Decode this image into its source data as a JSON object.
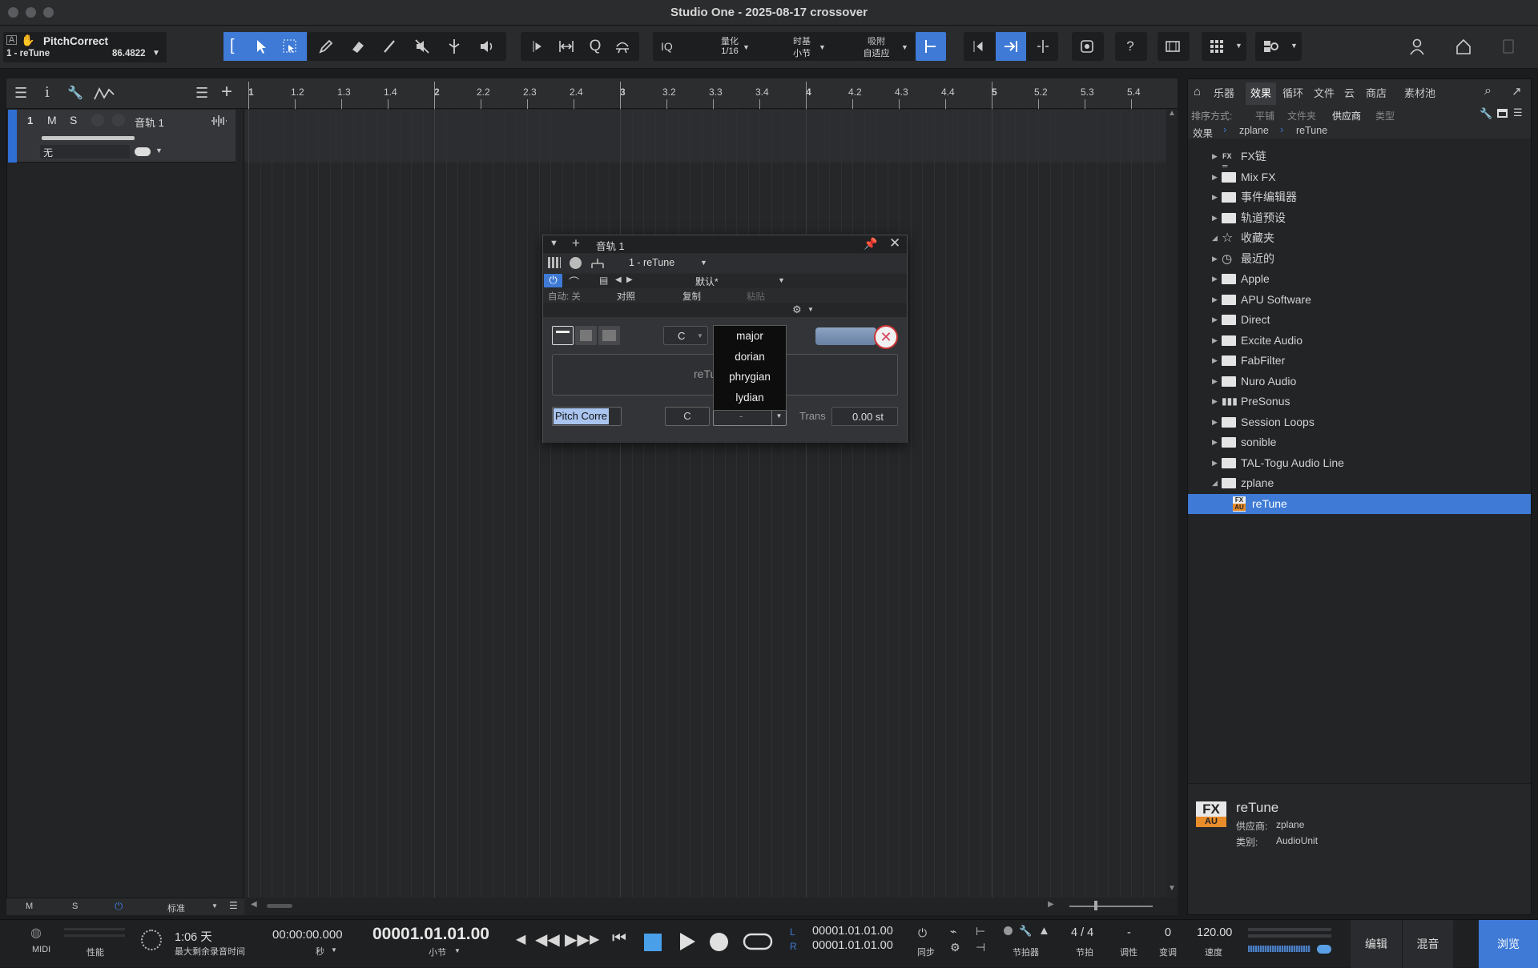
{
  "window": {
    "title": "Studio One - 2025-08-17 crossover"
  },
  "toolbar": {
    "track_name": "PitchCorrect",
    "track_sub": "1 - reTune",
    "track_value": "86.4822",
    "iq": "IQ",
    "quantize_label": "量化",
    "quantize_value": "1/16",
    "timebase_label": "时基",
    "timebase_value": "小节",
    "snap_label": "吸附",
    "snap_value": "自适应",
    "help": "?"
  },
  "ruler": {
    "ticks": [
      "1",
      "1.2",
      "1.3",
      "1.4",
      "2",
      "2.2",
      "2.3",
      "2.4",
      "3",
      "3.2",
      "3.3",
      "3.4",
      "4",
      "4.2",
      "4.3",
      "4.4",
      "5",
      "5.2",
      "5.3",
      "5.4"
    ]
  },
  "track": {
    "number": "1",
    "mute": "M",
    "solo": "S",
    "name": "音轨 1",
    "input": "无"
  },
  "left_footer": {
    "m": "M",
    "s": "S",
    "mode": "标准"
  },
  "plugin": {
    "track": "音轨 1",
    "preset_slot": "1 - reTune",
    "preset_name": "默认*",
    "auto": "自动: 关",
    "compare": "对照",
    "copy": "复制",
    "paste": "粘贴",
    "key": "C",
    "retune_label": "reTu",
    "mode_button": "Pitch Corre",
    "root": "C",
    "scale_value": "-",
    "trans_label": "Trans",
    "trans_value": "0.00 st",
    "scale_options": [
      "major",
      "dorian",
      "phrygian",
      "lydian"
    ]
  },
  "browser": {
    "tabs": [
      "乐器",
      "效果",
      "循环",
      "文件",
      "云",
      "商店",
      "素材池"
    ],
    "active_tab": "效果",
    "sort_label": "排序方式:",
    "sort_options": [
      "平铺",
      "文件夹",
      "供应商",
      "类型"
    ],
    "active_sort": "供应商",
    "breadcrumb": [
      "效果",
      "zplane",
      "reTune"
    ],
    "items": [
      {
        "label": "FX链",
        "icon": "fx-chain"
      },
      {
        "label": "Mix FX",
        "icon": "folder"
      },
      {
        "label": "事件编辑器",
        "icon": "folder"
      },
      {
        "label": "轨道预设",
        "icon": "folder"
      },
      {
        "label": "收藏夹",
        "icon": "star"
      },
      {
        "label": "最近的",
        "icon": "clock"
      },
      {
        "label": "Apple",
        "icon": "folder"
      },
      {
        "label": "APU Software",
        "icon": "folder"
      },
      {
        "label": "Direct",
        "icon": "folder"
      },
      {
        "label": "Excite Audio",
        "icon": "folder"
      },
      {
        "label": "FabFilter",
        "icon": "folder"
      },
      {
        "label": "Nuro Audio",
        "icon": "folder"
      },
      {
        "label": "PreSonus",
        "icon": "presonus"
      },
      {
        "label": "Session Loops",
        "icon": "folder"
      },
      {
        "label": "sonible",
        "icon": "folder"
      },
      {
        "label": "TAL-Togu Audio Line",
        "icon": "folder"
      },
      {
        "label": "zplane",
        "icon": "folder-open"
      },
      {
        "label": "reTune",
        "icon": "fx-au"
      }
    ],
    "info": {
      "name": "reTune",
      "vendor_label": "供应商:",
      "vendor": "zplane",
      "category_label": "类别:",
      "category": "AudioUnit",
      "badge_top": "FX",
      "badge_bottom": "AU"
    }
  },
  "transport": {
    "midi": "MIDI",
    "perf": "性能",
    "record_time": "1:06 天",
    "record_label": "最大剩余录音时间",
    "time_seconds": "00:00:00.000",
    "seconds_label": "秒",
    "position": "00001.01.01.00",
    "position_label": "小节",
    "loop_l": "00001.01.01.00",
    "loop_r": "00001.01.01.00",
    "l": "L",
    "r": "R",
    "sync": "同步",
    "metronome": "节拍器",
    "time_sig": "4 / 4",
    "time_sig_label": "节拍",
    "key": "-",
    "key_label": "调性",
    "transpose": "0",
    "transpose_label": "变调",
    "tempo": "120.00",
    "tempo_label": "速度",
    "edit": "编辑",
    "mix": "混音",
    "browse": "浏览"
  }
}
